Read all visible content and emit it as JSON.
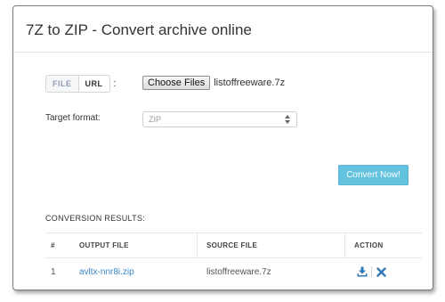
{
  "page": {
    "title": "7Z to ZIP - Convert archive online"
  },
  "source_toggle": {
    "options": [
      "FILE",
      "URL"
    ],
    "selected": "URL",
    "colon": ":"
  },
  "file_input": {
    "button_label": "Choose Files",
    "selected_file": "listoffreeware.7z"
  },
  "target_format": {
    "label": "Target format:",
    "selected": "ZIP"
  },
  "convert_button": {
    "label": "Convert Now!"
  },
  "results": {
    "heading": "CONVERSION RESULTS:",
    "columns": [
      "#",
      "OUTPUT FILE",
      "SOURCE FILE",
      "ACTION"
    ],
    "rows": [
      {
        "index": "1",
        "output_file": "avltx-nnr8i.zip",
        "source_file": "listoffreeware.7z"
      }
    ]
  },
  "icons": {
    "download": "download-icon",
    "delete": "close-icon",
    "select_arrows": "select-arrows-icon"
  },
  "colors": {
    "accent": "#63c2de",
    "link": "#3a87c7",
    "action_icon": "#2f78b7"
  }
}
